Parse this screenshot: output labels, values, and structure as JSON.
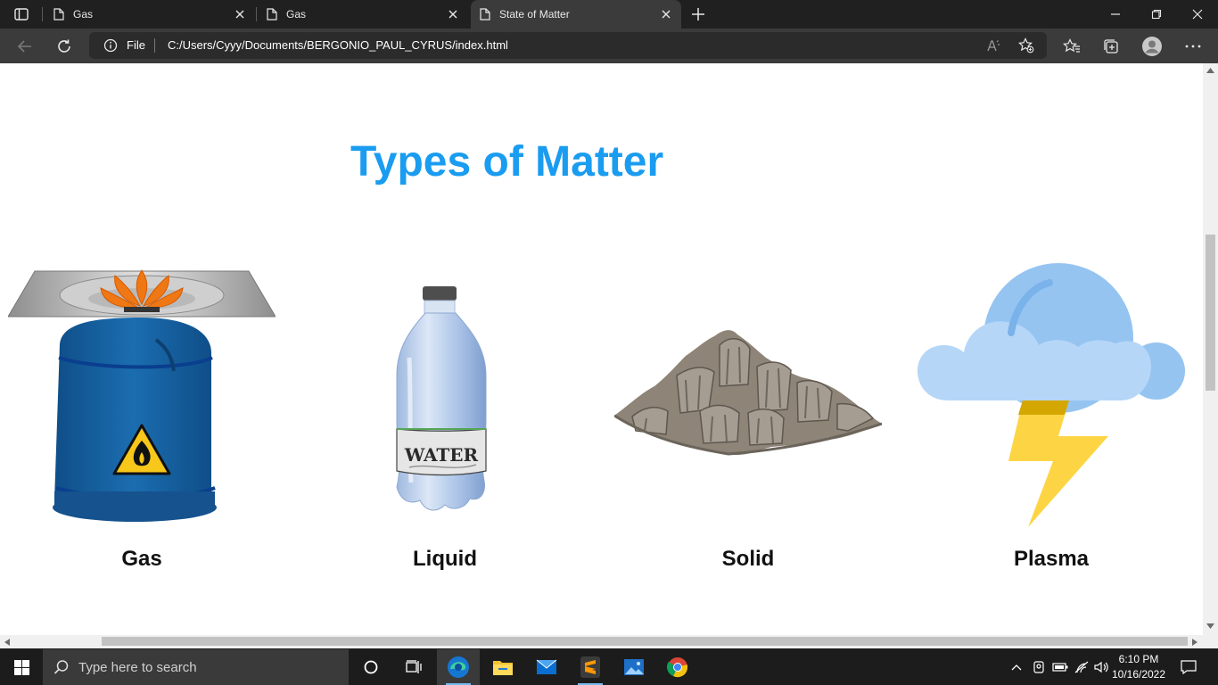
{
  "browser": {
    "tabs": [
      {
        "label": "Gas",
        "active": false
      },
      {
        "label": "Gas",
        "active": false
      },
      {
        "label": "State of Matter",
        "active": true
      }
    ],
    "address": {
      "scheme_label": "File",
      "url": "C:/Users/Cyyy/Documents/BERGONIO_PAUL_CYRUS/index.html"
    }
  },
  "page": {
    "title": "Types of Matter",
    "items": [
      {
        "caption": "Gas",
        "icon": "gas-canister-stove-icon"
      },
      {
        "caption": "Liquid",
        "icon": "water-bottle-icon"
      },
      {
        "caption": "Solid",
        "icon": "rock-icon"
      },
      {
        "caption": "Plasma",
        "icon": "lightning-cloud-icon"
      }
    ],
    "bottle_label": "WATER",
    "title_color": "#1a9cf0"
  },
  "taskbar": {
    "search_placeholder": "Type here to search",
    "time": "6:10 PM",
    "date": "10/16/2022"
  }
}
